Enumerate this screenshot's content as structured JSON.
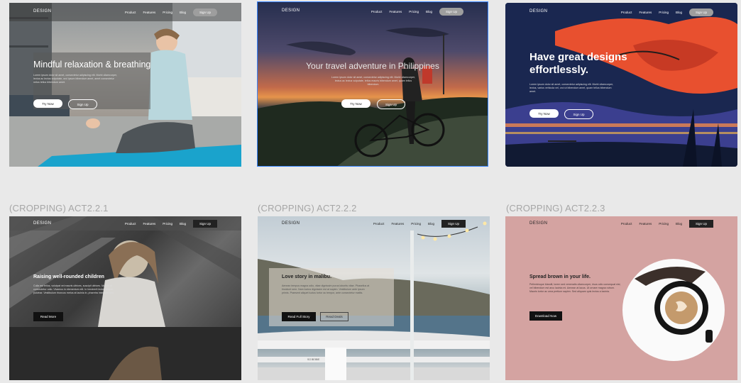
{
  "nav": {
    "logo": "DESIGN",
    "items": [
      "Product",
      "Features",
      "Pricing",
      "Blog"
    ],
    "signup": "Sign Up"
  },
  "cards": [
    {
      "heading": "Mindful relaxation & breathing",
      "body": "Lorem ipsum dolor sit amet, consectetur adipiscing elit. Morbi ullamcorper, lectus ac lectus vulputate, orci ipsum bibendum amet, amet consectetur netus tellus bibendum amet.",
      "primary": "Try Now",
      "secondary": "Sign Up"
    },
    {
      "heading": "Your travel adventure in Philippines",
      "body": "Lorem ipsum dolor sit amet, consectetur adipiscing elit. Morbi ullamcorper, lectus ac lectus vulputate, tellus mauris bibendum amet, quam tellus bibendum.",
      "primary": "Try Now",
      "secondary": "Sign Up"
    },
    {
      "heading": "Have great designs effortlessly.",
      "body": "Lorem ipsum dolor sit amet, consectetur adipiscing elit. Morbi ullamcorper, lectus, varius vehicula vel, orci ut bibendum amet, quam tellus bibendum amet.",
      "primary": "Try Now",
      "secondary": "Sign Up"
    },
    {
      "label": "(CROPPING) ACT2.2.1",
      "heading": "Raising well-rounded children",
      "body": "Culla est tellus, volutpat vel mauris ultrices, suscipit ultrices. Mauris et consectetur odio. Vivamus in elementum elit. In hendrerit lectus aliquet pulvinar. Vestibulum rhoncus metus at lacinia in, pharetra interdum sed.",
      "primary": "Read More"
    },
    {
      "label": "(CROPPING) ACT2.2.2",
      "heading": "Love story in malibu.",
      "body": "Aenean tempus magna odio, vitae dignissim purus lobortis vitae. Phasellus at tincidunt sem. Nam luctus dignissim est at sapien. Vestibulum ante ipsum primis. Praesent aliquet luctus tortor ac tempor, ante consectetur mattis.",
      "primary": "Read Full Story",
      "secondary": "Read Deals"
    },
    {
      "label": "(CROPPING) ACT2.2.3",
      "heading": "Spread brown in your life.",
      "body": "Pellentesque blandit, lorem sed venenatis ullamcorper, risus odio consequat nisl, vel bibendum est arcu lacinia mi. Aenean at lacus. Ut ornare magna rutrum. Mauris tortor ac urna pretium sapien. Sed aliquam quis lectus a lacinia.",
      "primary": "Download Now"
    }
  ],
  "sign_text": "SO BEIBIE"
}
